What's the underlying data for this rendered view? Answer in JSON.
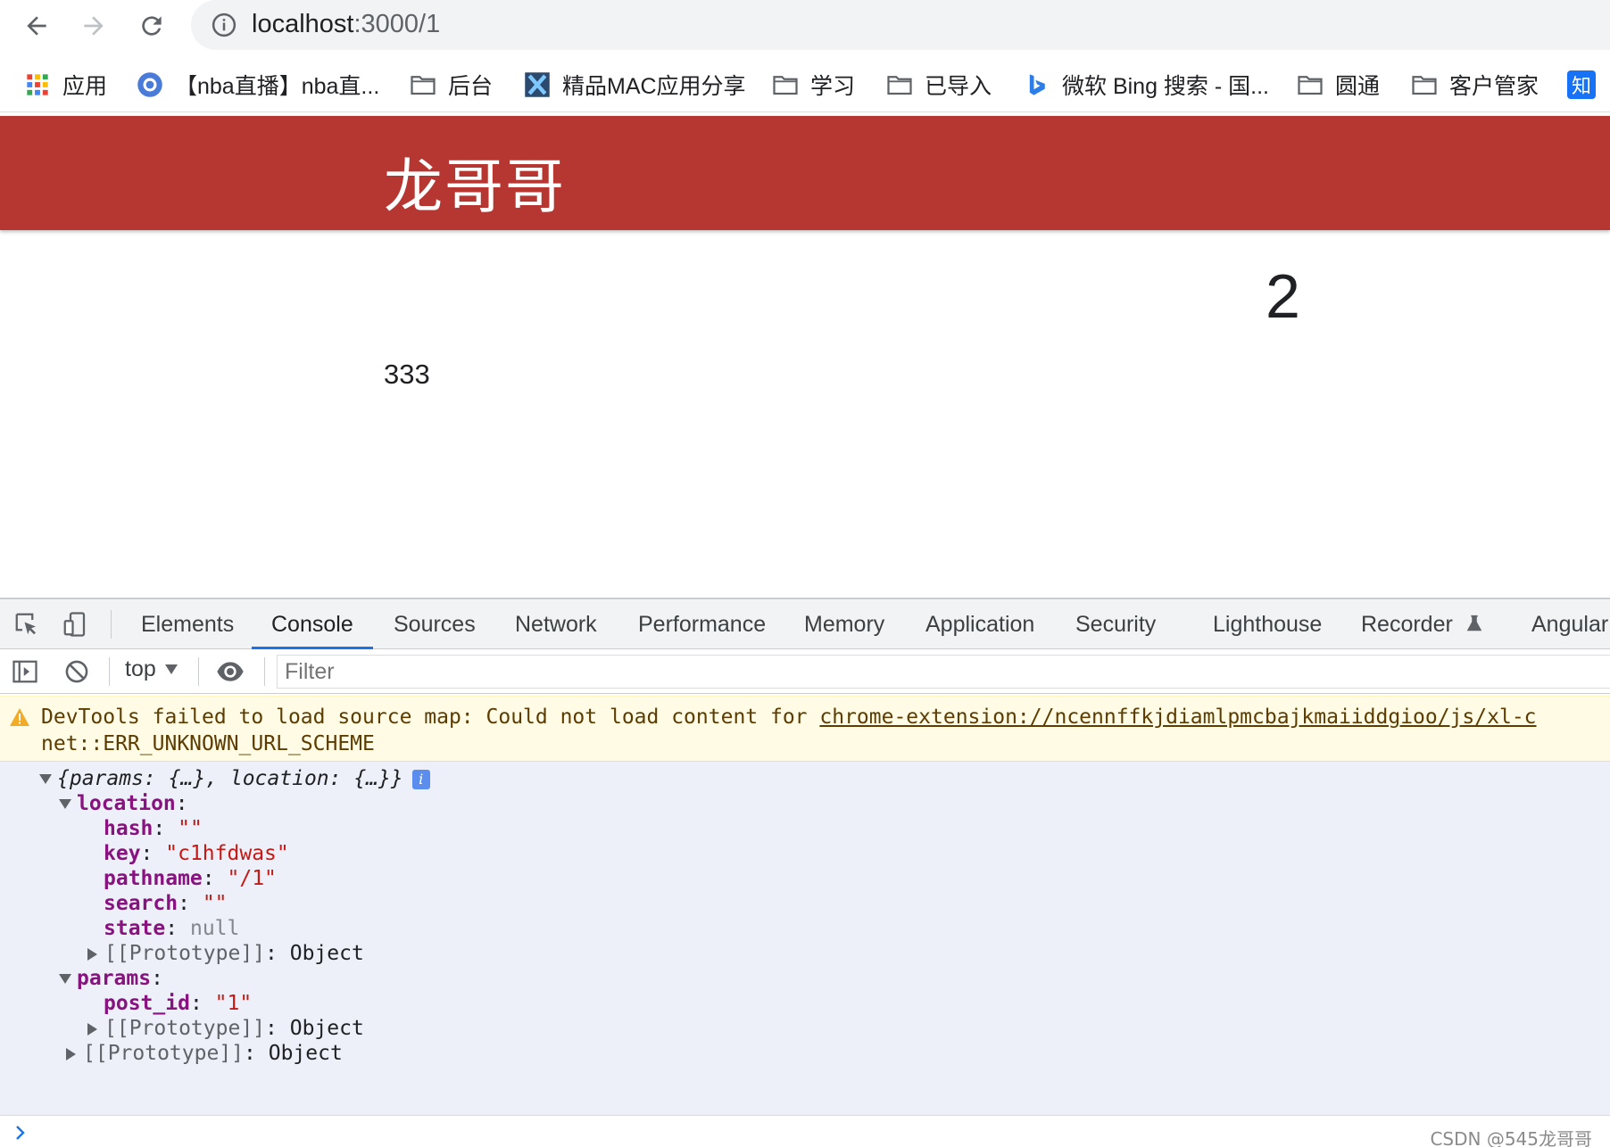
{
  "browser": {
    "url_host": "localhost",
    "url_path": ":3000/1",
    "bookmarks": [
      {
        "label": "应用",
        "icon": "apps-grid-icon"
      },
      {
        "label": "【nba直播】nba直...",
        "icon": "nba-site-icon"
      },
      {
        "label": "后台",
        "icon": "folder-icon"
      },
      {
        "label": "精品MAC应用分享",
        "icon": "x-site-icon"
      },
      {
        "label": "学习",
        "icon": "folder-icon"
      },
      {
        "label": "已导入",
        "icon": "folder-icon"
      },
      {
        "label": "微软 Bing 搜索 - 国...",
        "icon": "bing-icon"
      },
      {
        "label": "圆通",
        "icon": "folder-icon"
      },
      {
        "label": "客户管家",
        "icon": "folder-icon"
      },
      {
        "label": "知",
        "icon": "zhihu-icon"
      }
    ]
  },
  "page": {
    "header_title": "龙哥哥",
    "big_number": "2",
    "small_text": "333"
  },
  "devtools": {
    "tabs": [
      "Elements",
      "Console",
      "Sources",
      "Network",
      "Performance",
      "Memory",
      "Application",
      "Security",
      "Lighthouse",
      "Recorder",
      "Angular"
    ],
    "active_tab": "Console",
    "context": "top",
    "filter_placeholder": "Filter",
    "warning": {
      "text": "DevTools failed to load source map: Could not load content for ",
      "link": "chrome-extension://ncennffkjdiamlpmcbajkmaiiddgioo/js/xl-c",
      "line2": "net::ERR_UNKNOWN_URL_SCHEME"
    },
    "log": {
      "summary": "{params: {…}, location: {…}}",
      "info_badge": "i",
      "location_key": "location",
      "hash_key": "hash",
      "hash_val": "\"\"",
      "key_key": "key",
      "key_val": "\"c1hfdwas\"",
      "pathname_key": "pathname",
      "pathname_val": "\"/1\"",
      "search_key": "search",
      "search_val": "\"\"",
      "state_key": "state",
      "state_val": "null",
      "proto_label": "[[Prototype]]",
      "proto_val": "Object",
      "params_key": "params",
      "post_id_key": "post_id",
      "post_id_val": "\"1\""
    },
    "colon": ":"
  },
  "watermark": "CSDN @545龙哥哥",
  "colors": {
    "header_red": "#b63631",
    "console_bg": "#edf0f8",
    "warning_bg": "#fffbe5",
    "active_tab_underline": "#1a73e8"
  }
}
